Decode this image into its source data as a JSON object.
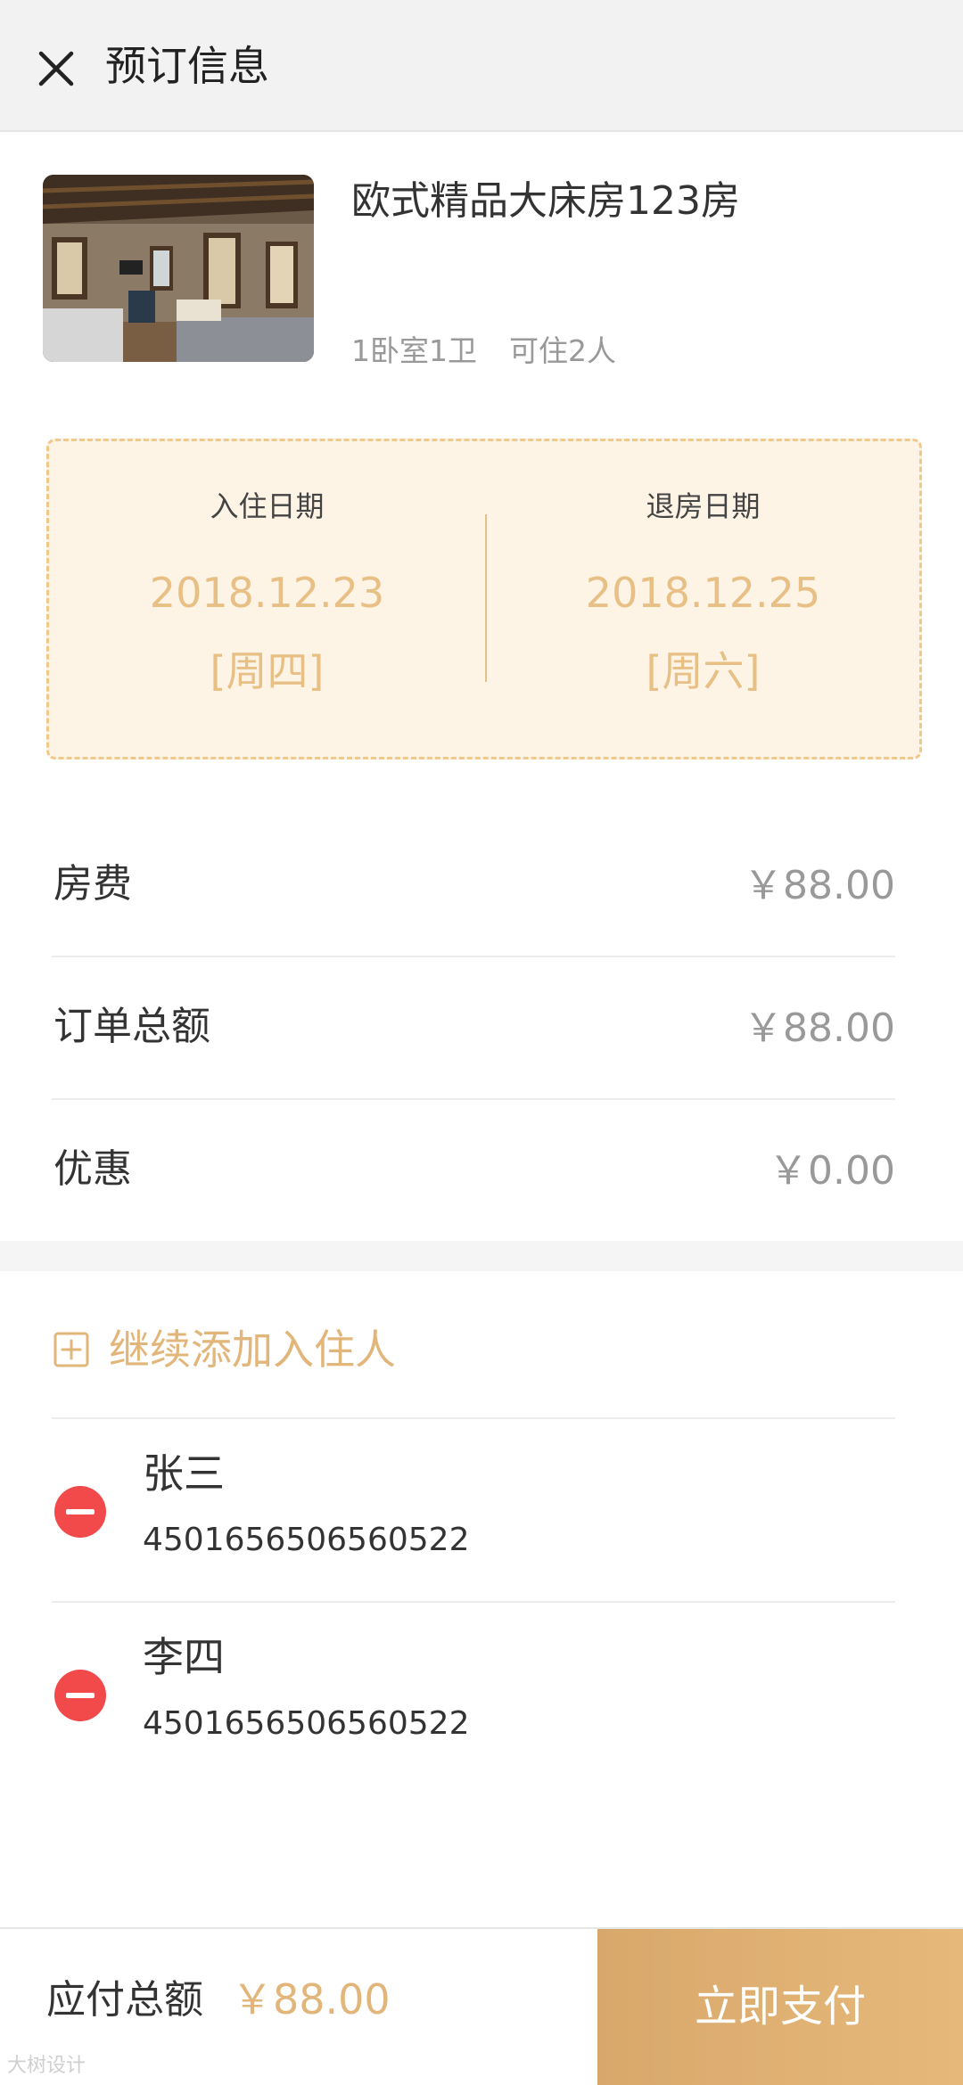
{
  "header": {
    "title": "预订信息",
    "close_icon": "close-icon"
  },
  "room": {
    "name": "欧式精品大床房123房",
    "bedrooms": "1卧室1卫",
    "capacity": "可住2人"
  },
  "dates": {
    "checkin": {
      "label": "入住日期",
      "date": "2018.12.23",
      "weekday": "[周四]"
    },
    "checkout": {
      "label": "退房日期",
      "date": "2018.12.25",
      "weekday": "[周六]"
    }
  },
  "fees": [
    {
      "label": "房费",
      "value": "￥88.00"
    },
    {
      "label": "订单总额",
      "value": "￥88.00"
    },
    {
      "label": "优惠",
      "value": "￥0.00"
    }
  ],
  "guests": {
    "add_label": "继续添加入住人",
    "list": [
      {
        "name": "张三",
        "id_number": "4501656506560522"
      },
      {
        "name": "李四",
        "id_number": "4501656506560522"
      }
    ]
  },
  "footer": {
    "total_label": "应付总额",
    "total_value": "￥88.00",
    "pay_button": "立即支付"
  },
  "watermark": "大树设计",
  "colors": {
    "accent": "#e2b67a",
    "date_box_bg": "#fdf4e6",
    "date_box_border": "#f0c98a",
    "remove_red": "#f24a4a",
    "pay_button": "#dfae6f"
  }
}
